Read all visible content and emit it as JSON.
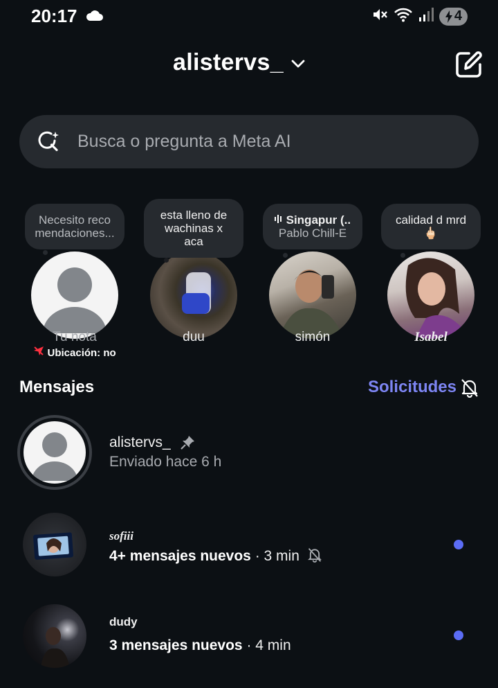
{
  "status_bar": {
    "time": "20:17",
    "battery": "4"
  },
  "header": {
    "account_name": "alistervs_"
  },
  "search": {
    "placeholder": "Busca o pregunta a Meta AI"
  },
  "notes": [
    {
      "text_line1": "Necesito reco",
      "text_line2": "mendaciones...",
      "name": "Tu nota",
      "sub": "Ubicación: no"
    },
    {
      "text_line1": "esta lleno de",
      "text_line2": "wachinas x",
      "text_line3": "aca",
      "name": "duu"
    },
    {
      "music_title": "Singapur (..",
      "music_artist": "Pablo Chill-E",
      "name": "simón"
    },
    {
      "text_line1": "calidad d mrd",
      "emoji": "🖕🏻",
      "name": "Isabel"
    }
  ],
  "messages": {
    "title": "Mensajes",
    "requests_label": "Solicitudes",
    "threads": [
      {
        "name": "alistervs_",
        "sub": "Enviado hace 6 h"
      },
      {
        "name": "sofiii",
        "sub_bold": "4+ mensajes nuevos",
        "separator": " · ",
        "time": "3 min"
      },
      {
        "name": "dudy",
        "sub_bold": "3 mensajes nuevos",
        "separator": " · ",
        "time": "4 min"
      }
    ]
  },
  "colors": {
    "background": "#0c1014",
    "accent": "#7d85f3",
    "unread": "#5b6cf5",
    "surface": "#262a2f"
  }
}
